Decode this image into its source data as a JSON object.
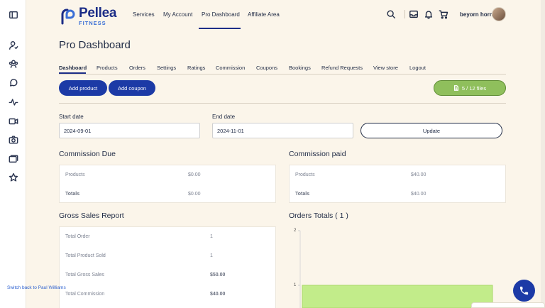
{
  "header": {
    "logo_name": "Pellea",
    "logo_sub": "FITNESS",
    "nav": [
      "Services",
      "My Account",
      "Pro Dashboard",
      "Affiliate Area"
    ],
    "active_nav": "Pro Dashboard",
    "user_name": "beyorn horn"
  },
  "page": {
    "title": "Pro Dashboard",
    "subnav": [
      "Dashboard",
      "Products",
      "Orders",
      "Settings",
      "Ratings",
      "Commission",
      "Coupons",
      "Bookings",
      "Refund Requests",
      "View store",
      "Logout"
    ],
    "add_product_label": "Add product",
    "add_coupon_label": "Add coupon",
    "files_label": "5 / 12 files"
  },
  "filters": {
    "start_label": "Start date",
    "start_value": "2024-09-01",
    "end_label": "End date",
    "end_value": "2024-11-01",
    "update_label": "Update"
  },
  "commission_due": {
    "title": "Commission Due",
    "rows": [
      {
        "label": "Products",
        "value": "$0.00"
      },
      {
        "label": "Totals",
        "value": "$0.00"
      }
    ]
  },
  "commission_paid": {
    "title": "Commission paid",
    "rows": [
      {
        "label": "Products",
        "value": "$40.00"
      },
      {
        "label": "Totals",
        "value": "$40.00"
      }
    ]
  },
  "gross_sales": {
    "title": "Gross Sales Report",
    "rows": [
      {
        "label": "Total Order",
        "value": "1"
      },
      {
        "label": "Total Product Sold",
        "value": "1"
      },
      {
        "label": "Total Gross Sales",
        "value": "$50.00"
      },
      {
        "label": "Total Commission",
        "value": "$40.00"
      }
    ]
  },
  "orders_totals": {
    "title": "Orders Totals ( 1 )"
  },
  "chart_data": {
    "type": "bar",
    "title": "Orders Totals ( 1 )",
    "y_ticks": [
      "2",
      "1"
    ],
    "ylim": [
      0,
      2
    ],
    "values": [
      1
    ],
    "bar_color": "#c2ec8a"
  },
  "footer": {
    "switch_link": "Switch back to Paul Williams"
  },
  "colors": {
    "primary": "#1c3aa6",
    "brand": "#1c2d87",
    "files_green": "#8fbf5c",
    "background": "#fbf5ea"
  },
  "icons": {
    "rail": [
      "sidebar-toggle-icon",
      "user-icon",
      "users-icon",
      "chat-icon",
      "activity-icon",
      "video-icon",
      "camera-icon",
      "gallery-icon",
      "star-icon"
    ],
    "top": [
      "search-icon",
      "inbox-icon",
      "bell-icon",
      "cart-icon"
    ]
  }
}
